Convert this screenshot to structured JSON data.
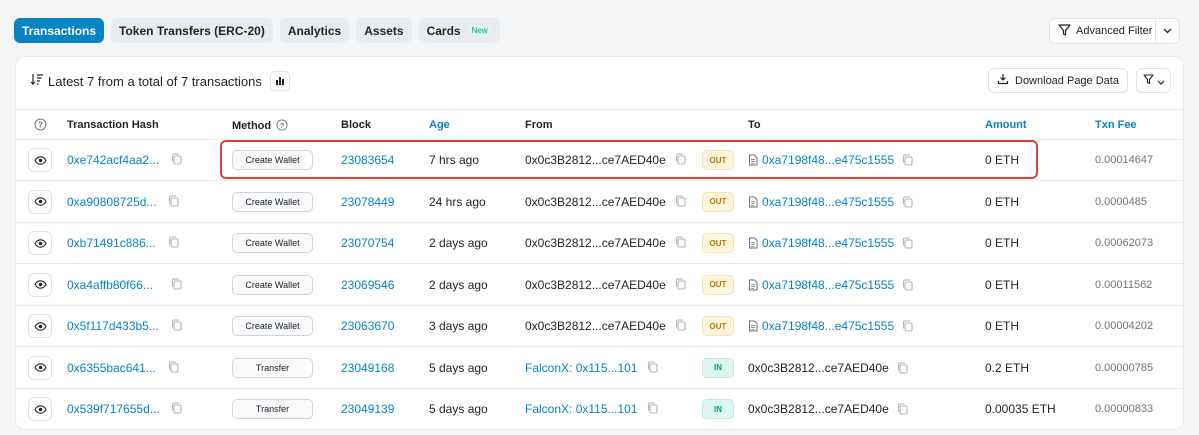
{
  "tabs": [
    {
      "label": "Transactions",
      "active": true
    },
    {
      "label": "Token Transfers (ERC-20)",
      "active": false
    },
    {
      "label": "Analytics",
      "active": false
    },
    {
      "label": "Assets",
      "active": false
    },
    {
      "label": "Cards",
      "active": false,
      "badge": "New"
    }
  ],
  "advanced_filter": {
    "label": "Advanced Filter"
  },
  "summary": {
    "text": "Latest 7 from a total of 7 transactions"
  },
  "download": {
    "label": "Download Page Data"
  },
  "columns": {
    "hash": "Transaction Hash",
    "method": "Method",
    "block": "Block",
    "age": "Age",
    "from": "From",
    "to": "To",
    "amount": "Amount",
    "fee": "Txn Fee"
  },
  "rows": [
    {
      "hash": "0xe742acf4aa2...",
      "method": "Create Wallet",
      "block": "23083654",
      "age": "7 hrs ago",
      "from": "0x0c3B2812...ce7AED40e",
      "direction": "OUT",
      "to": "0xa7198f48...e475c1555",
      "amount": "0 ETH",
      "fee": "0.00014647"
    },
    {
      "hash": "0xa90808725d...",
      "method": "Create Wallet",
      "block": "23078449",
      "age": "24 hrs ago",
      "from": "0x0c3B2812...ce7AED40e",
      "direction": "OUT",
      "to": "0xa7198f48...e475c1555",
      "amount": "0 ETH",
      "fee": "0.0000485"
    },
    {
      "hash": "0xb71491c886...",
      "method": "Create Wallet",
      "block": "23070754",
      "age": "2 days ago",
      "from": "0x0c3B2812...ce7AED40e",
      "direction": "OUT",
      "to": "0xa7198f48...e475c1555",
      "amount": "0 ETH",
      "fee": "0.00062073"
    },
    {
      "hash": "0xa4affb80f66...",
      "method": "Create Wallet",
      "block": "23069546",
      "age": "2 days ago",
      "from": "0x0c3B2812...ce7AED40e",
      "direction": "OUT",
      "to": "0xa7198f48...e475c1555",
      "amount": "0 ETH",
      "fee": "0.00011562"
    },
    {
      "hash": "0x5f117d433b5...",
      "method": "Create Wallet",
      "block": "23063670",
      "age": "3 days ago",
      "from": "0x0c3B2812...ce7AED40e",
      "direction": "OUT",
      "to": "0xa7198f48...e475c1555",
      "amount": "0 ETH",
      "fee": "0.00004202"
    },
    {
      "hash": "0x6355bac641...",
      "method": "Transfer",
      "block": "23049168",
      "age": "5 days ago",
      "from": "FalconX: 0x115...101",
      "direction": "IN",
      "to": "0x0c3B2812...ce7AED40e",
      "amount": "0.2 ETH",
      "fee": "0.00000785"
    },
    {
      "hash": "0x539f717655d...",
      "method": "Transfer",
      "block": "23049139",
      "age": "5 days ago",
      "from": "FalconX: 0x115...101",
      "direction": "IN",
      "to": "0x0c3B2812...ce7AED40e",
      "amount": "0.00035 ETH",
      "fee": "0.00000833"
    }
  ],
  "colors": {
    "accent": "#0784c3",
    "highlight_border": "#d9452f",
    "out_badge": "#b47d00",
    "in_badge": "#00a186"
  }
}
